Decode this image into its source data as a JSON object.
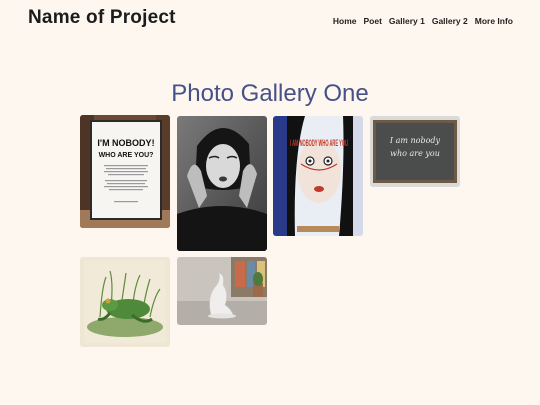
{
  "header": {
    "site_title": "Name of Project"
  },
  "nav": {
    "items": [
      "Home",
      "Poet",
      "Gallery 1",
      "Gallery 2",
      "More Info"
    ]
  },
  "main": {
    "title": "Photo Gallery One"
  },
  "gallery": {
    "photos": [
      {
        "sign_line1": "I'M NOBODY!",
        "sign_line2": "WHO ARE YOU?"
      },
      {},
      {
        "art_text": "I AM NOBODY WHO ARE YOU"
      },
      {
        "board_line1": "I am nobody",
        "board_line2": "who are you"
      },
      {},
      {}
    ]
  }
}
